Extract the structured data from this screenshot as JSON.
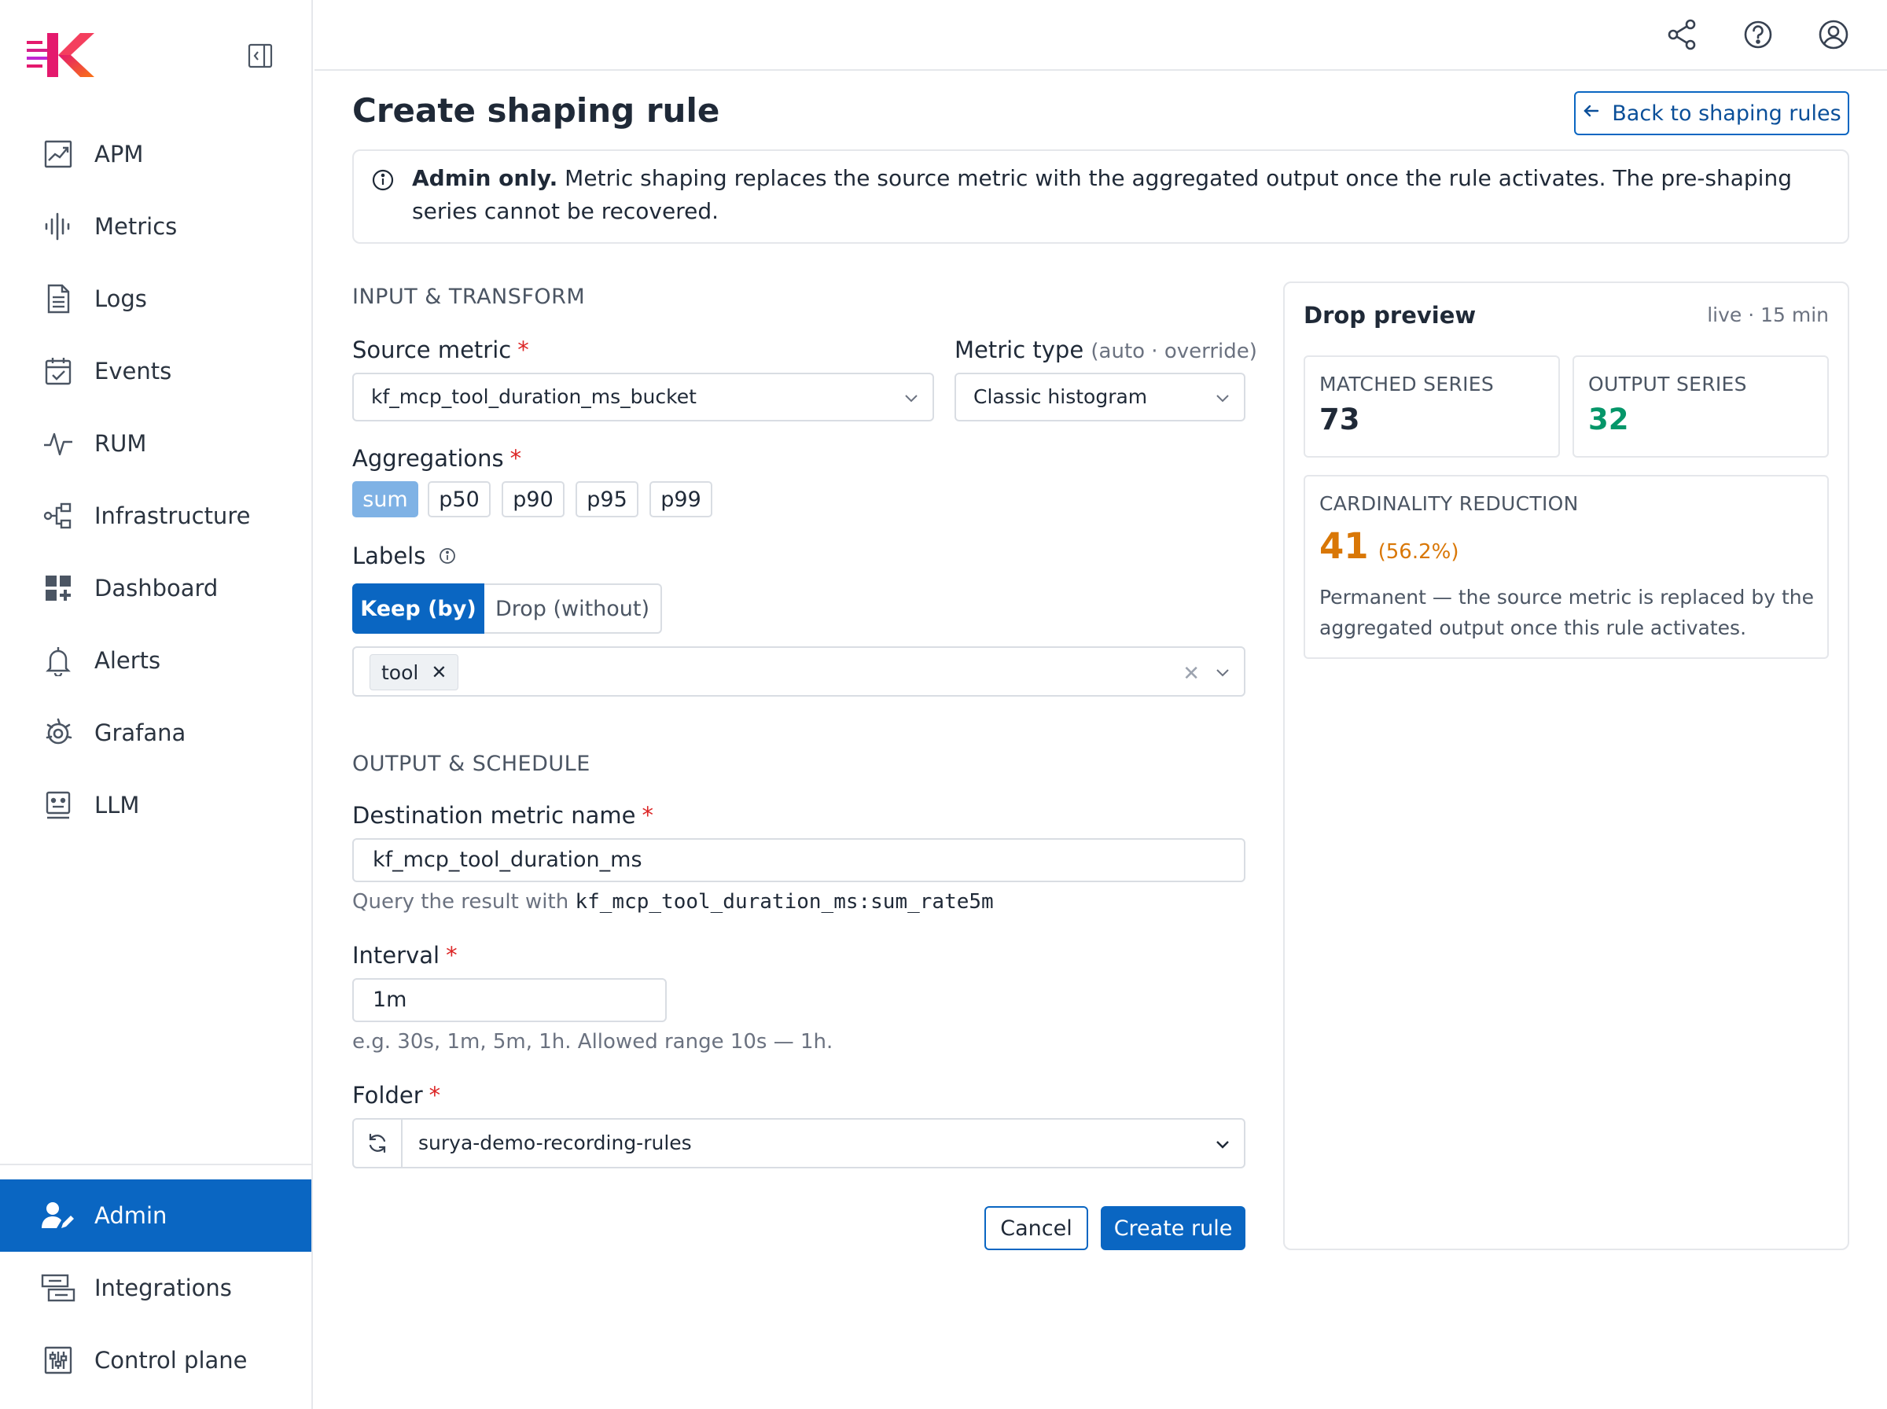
{
  "sidebar": {
    "items": [
      {
        "label": "APM",
        "icon": "apm-chart-icon"
      },
      {
        "label": "Metrics",
        "icon": "metrics-waveform-icon"
      },
      {
        "label": "Logs",
        "icon": "logs-document-icon"
      },
      {
        "label": "Events",
        "icon": "events-calendar-icon"
      },
      {
        "label": "RUM",
        "icon": "rum-pulse-icon"
      },
      {
        "label": "Infrastructure",
        "icon": "infrastructure-nodes-icon"
      },
      {
        "label": "Dashboard",
        "icon": "dashboard-grid-icon"
      },
      {
        "label": "Alerts",
        "icon": "alerts-bell-icon"
      },
      {
        "label": "Grafana",
        "icon": "grafana-gear-icon"
      },
      {
        "label": "LLM",
        "icon": "llm-bot-icon"
      }
    ],
    "bottom_items": [
      {
        "label": "Admin",
        "icon": "admin-user-icon",
        "active": true
      },
      {
        "label": "Integrations",
        "icon": "integrations-icon"
      },
      {
        "label": "Control plane",
        "icon": "control-plane-sliders-icon"
      }
    ]
  },
  "topbar": {
    "icons": [
      "share-icon",
      "help-icon",
      "user-account-icon"
    ]
  },
  "page": {
    "title": "Create shaping rule",
    "back_label": "Back to shaping rules"
  },
  "alert": {
    "bold": "Admin only.",
    "text": " Metric shaping replaces the source metric with the aggregated output once the rule activates. The pre-shaping series cannot be recovered."
  },
  "input_section": {
    "heading": "INPUT & TRANSFORM",
    "source_metric_label": "Source metric",
    "source_metric_value": "kf_mcp_tool_duration_ms_bucket",
    "metric_type_label": "Metric type",
    "metric_type_hint": "(auto · override)",
    "metric_type_value": "Classic histogram",
    "aggregations_label": "Aggregations",
    "aggregations": [
      {
        "label": "sum",
        "selected": true
      },
      {
        "label": "p50",
        "selected": false
      },
      {
        "label": "p90",
        "selected": false
      },
      {
        "label": "p95",
        "selected": false
      },
      {
        "label": "p99",
        "selected": false
      }
    ],
    "labels_label": "Labels",
    "keep_label": "Keep (by)",
    "drop_label": "Drop (without)",
    "selected_tags": [
      "tool"
    ],
    "required_mark": "*"
  },
  "output_section": {
    "heading": "OUTPUT & SCHEDULE",
    "dest_label": "Destination metric name",
    "dest_value": "kf_mcp_tool_duration_ms",
    "query_help": "Query the result with ",
    "query_code": "kf_mcp_tool_duration_ms:sum_rate5m",
    "interval_label": "Interval",
    "interval_value": "1m",
    "interval_help": "e.g. 30s, 1m, 5m, 1h. Allowed range 10s — 1h.",
    "folder_label": "Folder",
    "folder_value": "surya-demo-recording-rules"
  },
  "actions": {
    "cancel": "Cancel",
    "create": "Create rule"
  },
  "preview": {
    "title": "Drop preview",
    "meta": "live · 15 min",
    "matched_label": "MATCHED SERIES",
    "matched_value": "73",
    "output_label": "OUTPUT SERIES",
    "output_value": "32",
    "reduction_label": "CARDINALITY REDUCTION",
    "reduction_value": "41",
    "reduction_pct": "(56.2%)",
    "reduction_desc": "Permanent — the source metric is replaced by the aggregated output once this rule activates."
  },
  "colors": {
    "accent": "#0a66c2",
    "positive": "#059669",
    "warning": "#d97706",
    "required": "#dc2626"
  }
}
